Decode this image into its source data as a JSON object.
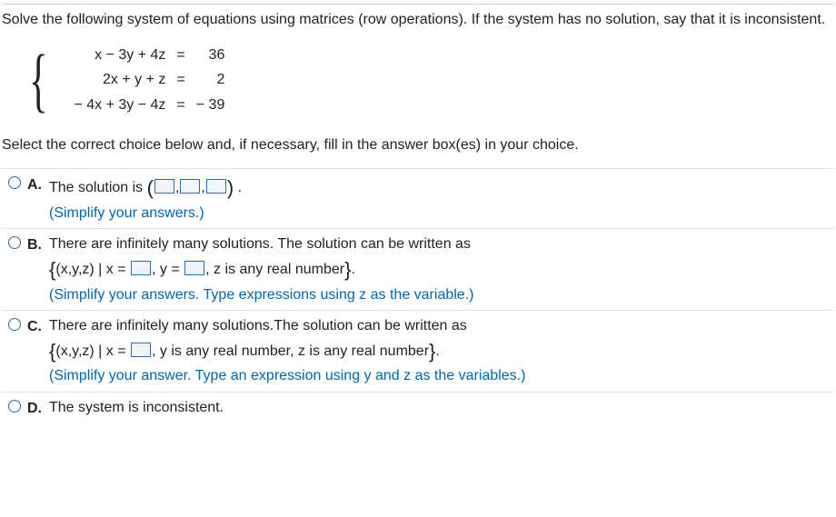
{
  "question": {
    "prompt": "Solve the following system of equations using matrices (row operations). If the system has no solution, say that it is inconsistent.",
    "equations": [
      {
        "lhs": "x − 3y + 4z",
        "eq": "=",
        "rhs": "36"
      },
      {
        "lhs": "2x + y + z",
        "eq": "=",
        "rhs": "2"
      },
      {
        "lhs": "− 4x + 3y − 4z",
        "eq": "=",
        "rhs": "− 39"
      }
    ],
    "instruction": "Select the correct choice below and, if necessary, fill in the answer box(es) in your choice."
  },
  "choices": {
    "A": {
      "letter": "A.",
      "pre": "The solution is ",
      "post": " .",
      "hint": "(Simplify your answers.)"
    },
    "B": {
      "letter": "B.",
      "line1": "There are infinitely many solutions. The solution can be written as",
      "set_pre": "(x,y,z) | x = ",
      "set_mid": ", y = ",
      "set_post": ", z is any real number",
      "period": ".",
      "hint": "(Simplify your answers. Type expressions using z as the variable.)"
    },
    "C": {
      "letter": "C.",
      "line1": "There are infinitely many solutions.The solution can be written as",
      "set_pre": "(x,y,z) | x = ",
      "set_post": ", y is any real number, z is any real number",
      "period": ".",
      "hint": "(Simplify your answer. Type an expression using y and z as the variables.)"
    },
    "D": {
      "letter": "D.",
      "text": "The system is inconsistent."
    }
  }
}
